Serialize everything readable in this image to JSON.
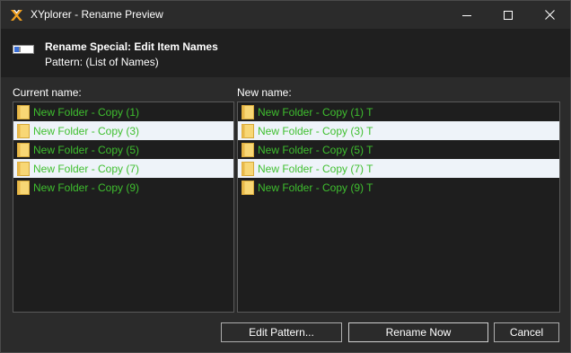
{
  "window": {
    "title": "XYplorer - Rename Preview"
  },
  "header": {
    "title": "Rename Special: Edit Item Names",
    "subtitle": "Pattern: (List of Names)"
  },
  "columns": {
    "current_label": "Current name:",
    "new_label": "New name:"
  },
  "current_names": [
    "New Folder - Copy (1)",
    "New Folder - Copy (3)",
    "New Folder - Copy (5)",
    "New Folder - Copy (7)",
    "New Folder - Copy (9)"
  ],
  "new_names": [
    "New Folder - Copy (1) T",
    "New Folder - Copy (3) T",
    "New Folder - Copy (5) T",
    "New Folder - Copy (7) T",
    "New Folder - Copy (9) T"
  ],
  "buttons": {
    "edit_pattern": "Edit Pattern...",
    "rename_now": "Rename Now",
    "cancel": "Cancel"
  },
  "colors": {
    "item_text": "#3fbf2f",
    "alt_row": "#eef3f9",
    "background": "#2b2b2b",
    "list_background": "#1e1e1e"
  },
  "icons": {
    "app": "xyplorer-logo-icon",
    "header": "rename-icon",
    "item": "folder-icon",
    "minimize": "minimize-icon",
    "maximize": "maximize-icon",
    "close": "close-icon"
  }
}
